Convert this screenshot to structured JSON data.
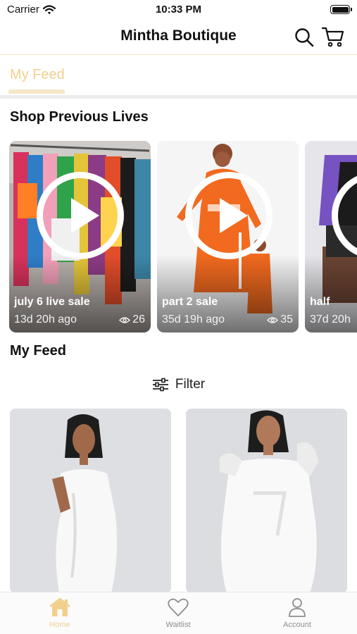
{
  "status_bar": {
    "carrier": "Carrier",
    "time": "10:33 PM"
  },
  "nav": {
    "title": "Mintha Boutique",
    "search_icon": "search-icon",
    "cart_icon": "cart-icon"
  },
  "tabs": [
    {
      "label": "My Feed",
      "active": true
    }
  ],
  "previous_lives": {
    "title": "Shop Previous Lives",
    "items": [
      {
        "title": "july 6 live sale",
        "time": "13d 20h ago",
        "views": "26"
      },
      {
        "title": "part 2 sale",
        "time": "35d 19h ago",
        "views": "35"
      },
      {
        "title": "half",
        "time": "37d 20h"
      }
    ]
  },
  "feed": {
    "title": "My Feed",
    "filter_label": "Filter"
  },
  "tab_bar": [
    {
      "label": "Home",
      "icon": "home-icon",
      "active": true
    },
    {
      "label": "Waitlist",
      "icon": "heart-icon",
      "active": false
    },
    {
      "label": "Account",
      "icon": "person-icon",
      "active": false
    }
  ],
  "colors": {
    "accent": "#f2cf8c",
    "accent_light": "#f6e7c6",
    "inactive": "#8e8e8e"
  }
}
